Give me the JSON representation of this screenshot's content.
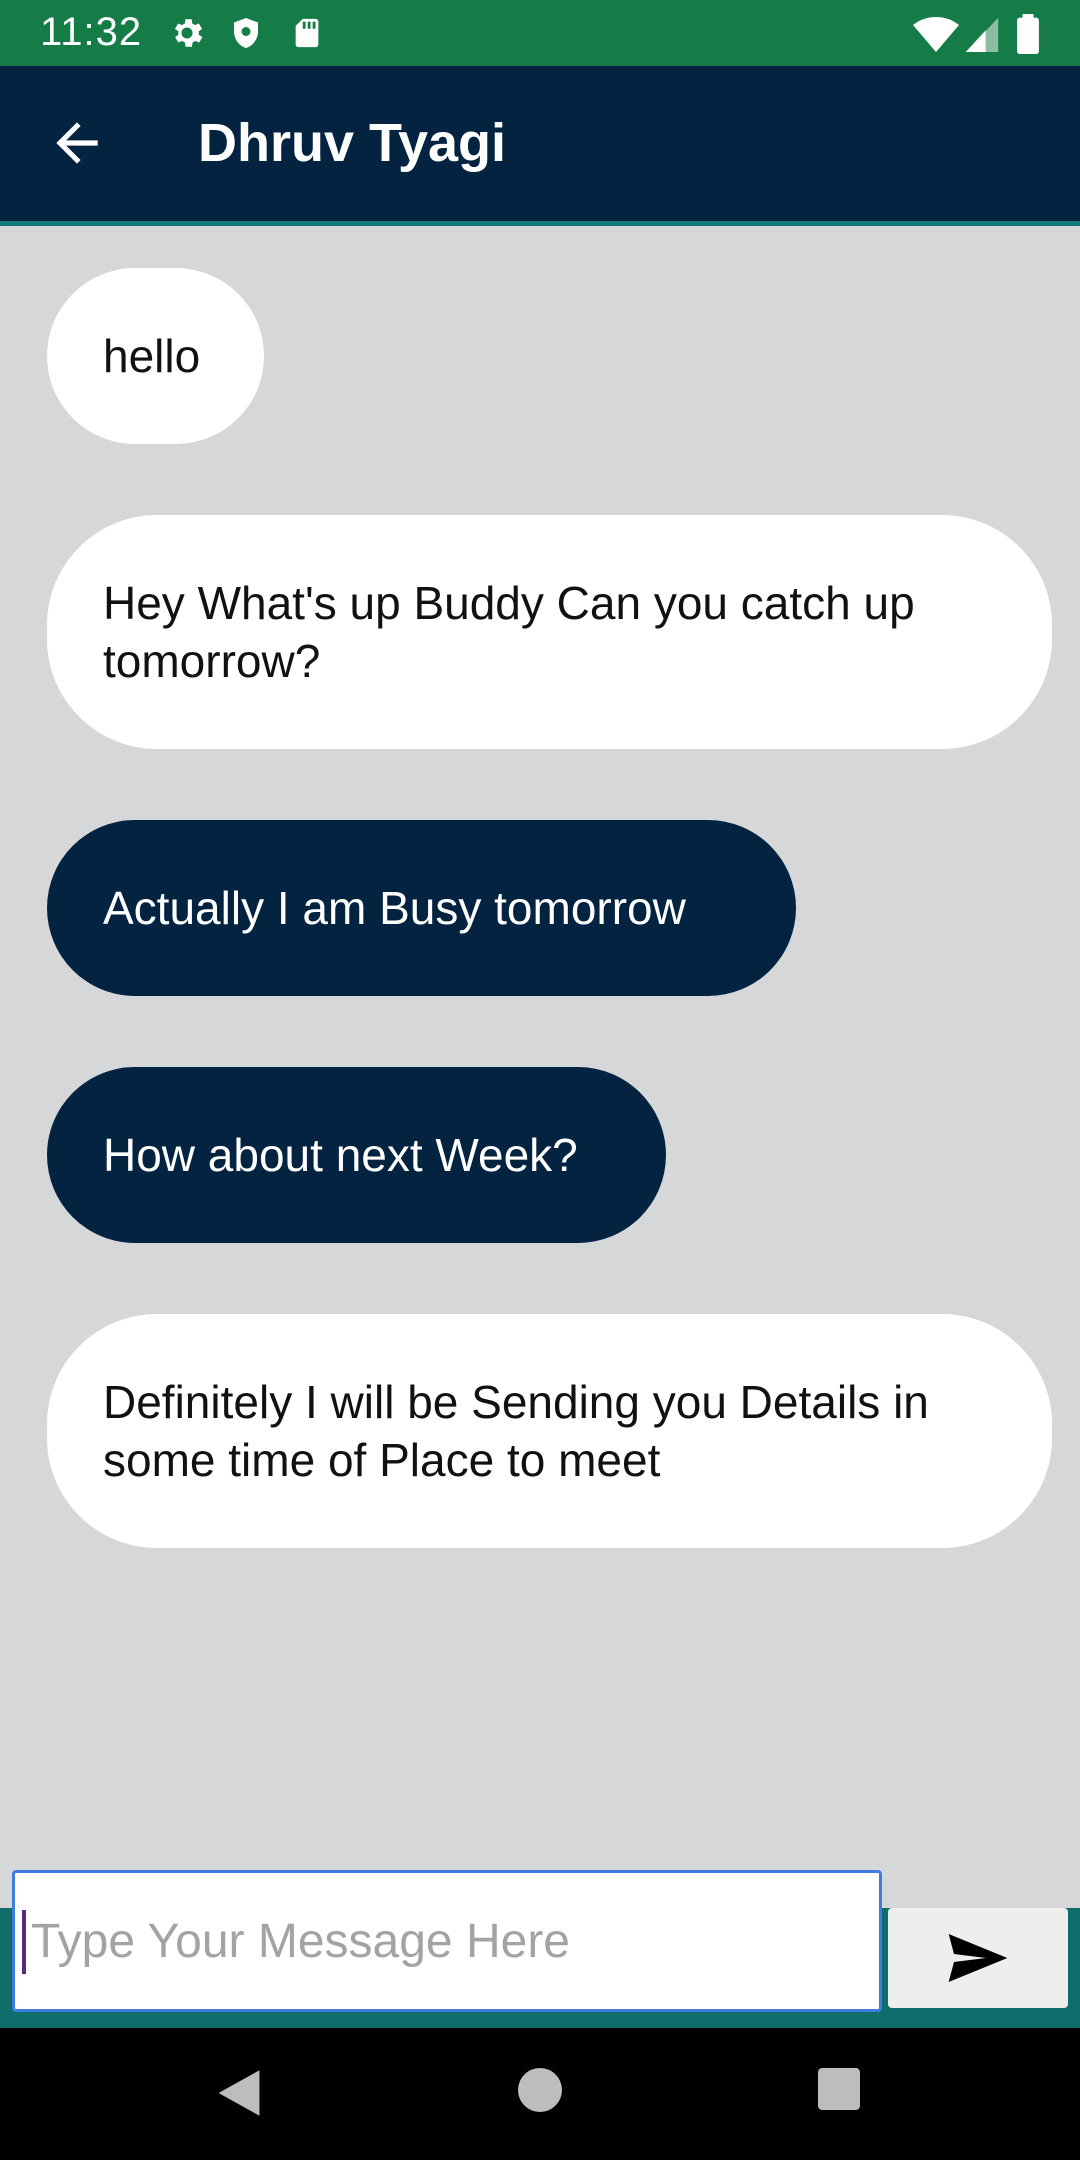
{
  "status_bar": {
    "time": "11:32",
    "left_icons": [
      "gear-icon",
      "shield-icon",
      "sd-card-icon"
    ],
    "right_icons": [
      "wifi-icon",
      "cell-signal-icon",
      "battery-icon"
    ],
    "color": "#167c47"
  },
  "header": {
    "title": "Dhruv Tyagi",
    "back_icon": "arrow-left-icon",
    "color": "#032340"
  },
  "messages": [
    {
      "direction": "incoming",
      "text": "hello"
    },
    {
      "direction": "incoming",
      "text": "Hey What's up Buddy Can you catch up tomorrow?"
    },
    {
      "direction": "outgoing",
      "text": "Actually I am Busy tomorrow"
    },
    {
      "direction": "outgoing",
      "text": "How about next Week?"
    },
    {
      "direction": "incoming",
      "text": "Definitely I will be Sending you Details in some time of Place to meet"
    }
  ],
  "composer": {
    "placeholder": "Type Your Message Here",
    "value": "",
    "send_icon": "send-icon"
  },
  "nav_bar": {
    "icons": [
      "back-triangle-icon",
      "home-circle-icon",
      "recents-square-icon"
    ]
  },
  "colors": {
    "chat_background": "#d6d7d9",
    "incoming_bubble": "#ffffff",
    "outgoing_bubble": "#032340",
    "accent": "#0f7a78"
  }
}
